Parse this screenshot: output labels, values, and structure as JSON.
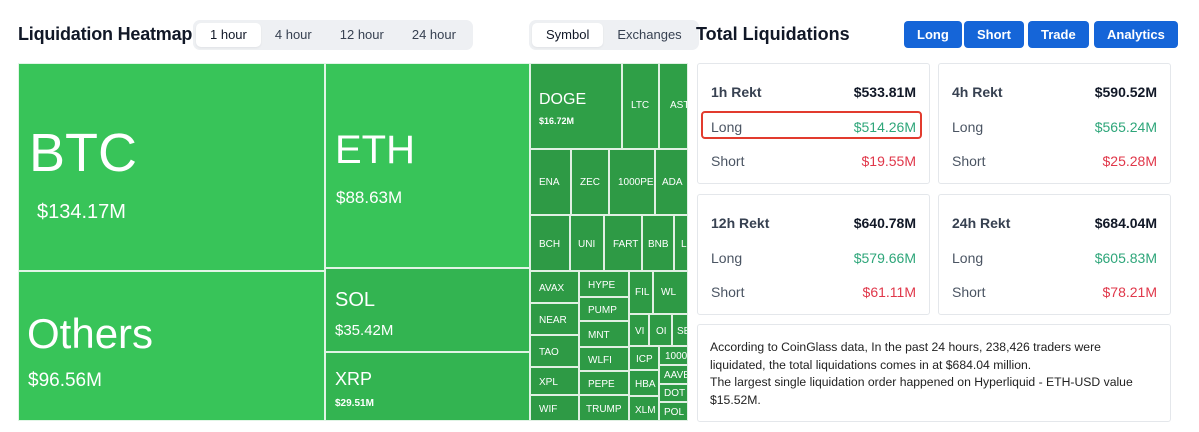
{
  "heatmap": {
    "title": "Liquidation Heatmap",
    "time_tabs": [
      "1 hour",
      "4 hour",
      "12 hour",
      "24 hour"
    ],
    "active_time_tab": "1 hour",
    "view_tabs": [
      "Symbol",
      "Exchanges"
    ],
    "active_view_tab": "Symbol",
    "cells": [
      {
        "symbol": "BTC",
        "value": "$134.17M"
      },
      {
        "symbol": "Others",
        "value": "$96.56M"
      },
      {
        "symbol": "ETH",
        "value": "$88.63M"
      },
      {
        "symbol": "SOL",
        "value": "$35.42M"
      },
      {
        "symbol": "XRP",
        "value": "$29.51M"
      },
      {
        "symbol": "DOGE",
        "value": "$16.72M"
      },
      {
        "symbol": "LTC",
        "value": ""
      },
      {
        "symbol": "AST",
        "value": ""
      },
      {
        "symbol": "ENA",
        "value": ""
      },
      {
        "symbol": "ZEC",
        "value": ""
      },
      {
        "symbol": "1000PE",
        "value": ""
      },
      {
        "symbol": "ADA",
        "value": ""
      },
      {
        "symbol": "BCH",
        "value": ""
      },
      {
        "symbol": "UNI",
        "value": ""
      },
      {
        "symbol": "FART",
        "value": ""
      },
      {
        "symbol": "BNB",
        "value": ""
      },
      {
        "symbol": "L",
        "value": ""
      },
      {
        "symbol": "AVAX",
        "value": ""
      },
      {
        "symbol": "HYPE",
        "value": ""
      },
      {
        "symbol": "FIL",
        "value": ""
      },
      {
        "symbol": "WL",
        "value": ""
      },
      {
        "symbol": "NEAR",
        "value": ""
      },
      {
        "symbol": "PUMP",
        "value": ""
      },
      {
        "symbol": "VI",
        "value": ""
      },
      {
        "symbol": "OI",
        "value": ""
      },
      {
        "symbol": "SE",
        "value": ""
      },
      {
        "symbol": "MNT",
        "value": ""
      },
      {
        "symbol": "TAO",
        "value": ""
      },
      {
        "symbol": "WLFI",
        "value": ""
      },
      {
        "symbol": "ICP",
        "value": ""
      },
      {
        "symbol": "1000",
        "value": ""
      },
      {
        "symbol": "XPL",
        "value": ""
      },
      {
        "symbol": "PEPE",
        "value": ""
      },
      {
        "symbol": "HBA",
        "value": ""
      },
      {
        "symbol": "AAVE",
        "value": ""
      },
      {
        "symbol": "DOT",
        "value": ""
      },
      {
        "symbol": "WIF",
        "value": ""
      },
      {
        "symbol": "TRUMP",
        "value": ""
      },
      {
        "symbol": "XLM",
        "value": ""
      },
      {
        "symbol": "POL",
        "value": ""
      }
    ]
  },
  "total": {
    "title": "Total Liquidations",
    "buttons": [
      "Long",
      "Short",
      "Trade",
      "Analytics"
    ],
    "cards": [
      {
        "title": "1h Rekt",
        "total": "$533.81M",
        "long_label": "Long",
        "long": "$514.26M",
        "short_label": "Short",
        "short": "$19.55M"
      },
      {
        "title": "4h Rekt",
        "total": "$590.52M",
        "long_label": "Long",
        "long": "$565.24M",
        "short_label": "Short",
        "short": "$25.28M"
      },
      {
        "title": "12h Rekt",
        "total": "$640.78M",
        "long_label": "Long",
        "long": "$579.66M",
        "short_label": "Short",
        "short": "$61.11M"
      },
      {
        "title": "24h Rekt",
        "total": "$684.04M",
        "long_label": "Long",
        "long": "$605.83M",
        "short_label": "Short",
        "short": "$78.21M"
      }
    ],
    "summary_line1": "According to CoinGlass data, In the past 24 hours, 238,426 traders were liquidated, the total liquidations comes in at $684.04 million.",
    "summary_line2": "The largest single liquidation order happened on Hyperliquid - ETH-USD value $15.52M."
  },
  "colors": {
    "accent": "#1565d8",
    "heat_large": "#38c459",
    "heat_small": "#2f9f47",
    "long": "#2ea67a",
    "short": "#e0374a",
    "highlight": "#e23b2e"
  }
}
